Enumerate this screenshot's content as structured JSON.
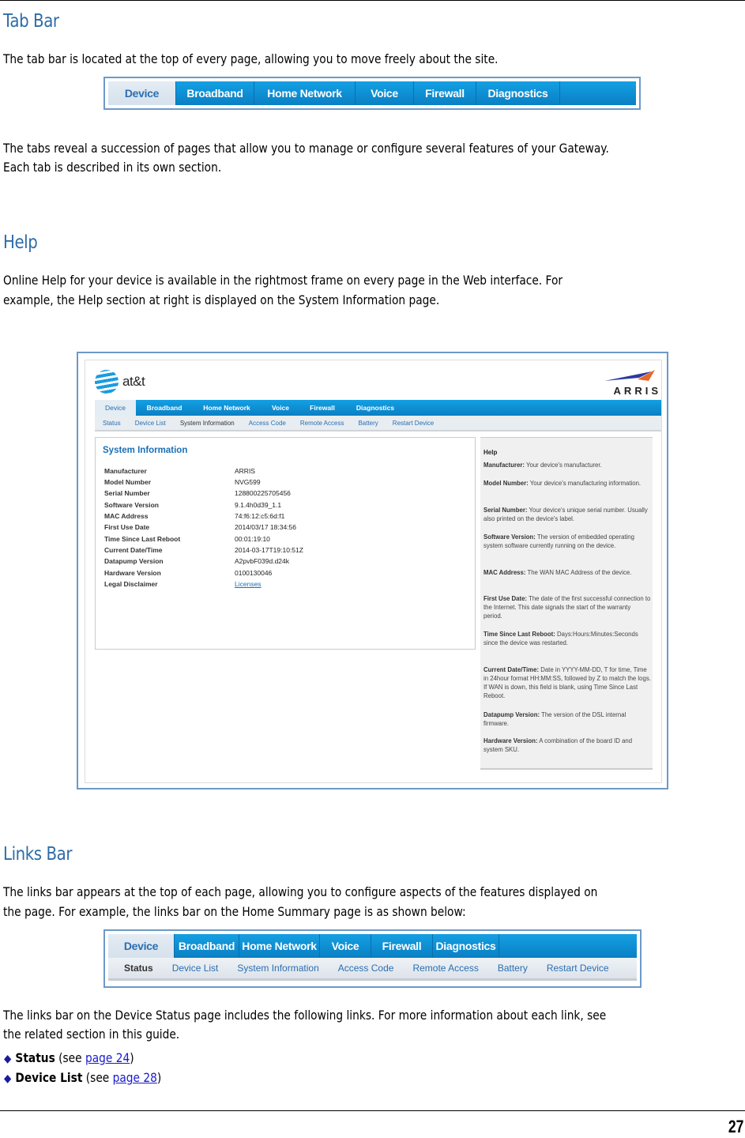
{
  "sections": {
    "tab_bar": {
      "heading": "Tab Bar",
      "intro": "The tab bar is located at the top of every page, allowing you to move freely about the site.",
      "tabs": [
        "Device",
        "Broadband",
        "Home Network",
        "Voice",
        "Firewall",
        "Diagnostics"
      ],
      "active_tab": "Device",
      "body_line1": "The tabs reveal a succession of pages that allow you to manage or configure several features of your Gateway.",
      "body_line2": "Each tab is described in its own section."
    },
    "help": {
      "heading": "Help",
      "body_line1": "Online Help for your device is available in the rightmost frame on every page in the Web interface. For",
      "body_line2": "example, the Help section at right is displayed on the System Information page."
    },
    "links_bar": {
      "heading": "Links Bar",
      "body_line1": "The links bar appears at the top of each page, allowing you to configure aspects of the features displayed on",
      "body_line2": "the page. For example, the links bar on the Home Summary page is as shown below:",
      "tabs": [
        "Device",
        "Broadband",
        "Home Network",
        "Voice",
        "Firewall",
        "Diagnostics"
      ],
      "links": [
        "Status",
        "Device List",
        "System Information",
        "Access Code",
        "Remote Access",
        "Battery",
        "Restart Device"
      ],
      "active_link": "Status",
      "after_line1": "The links bar on the Device Status page includes the following links. For more information about each link, see",
      "after_line2": "the related section in this guide.",
      "bullets": [
        {
          "term": "Status",
          "see": " (see ",
          "link": "page 24",
          "close": ")"
        },
        {
          "term": "Device List",
          "see": " (see ",
          "link": "page 28",
          "close": ")"
        }
      ]
    }
  },
  "embedded_screenshot": {
    "brand_left": "at&t",
    "brand_right": "ARRIS",
    "tabs": [
      "Device",
      "Broadband",
      "Home Network",
      "Voice",
      "Firewall",
      "Diagnostics"
    ],
    "links": [
      "Status",
      "Device List",
      "System Information",
      "Access Code",
      "Remote Access",
      "Battery",
      "Restart Device"
    ],
    "active_link": "System Information",
    "panel_title": "System Information",
    "rows": [
      {
        "label": "Manufacturer",
        "value": "ARRIS"
      },
      {
        "label": "Model Number",
        "value": "NVG599"
      },
      {
        "label": "Serial Number",
        "value": "128800225705456"
      },
      {
        "label": "Software Version",
        "value": "9.1.4h0d39_1.1"
      },
      {
        "label": "MAC Address",
        "value": "74:f6:12:c5:6d:f1"
      },
      {
        "label": "First Use Date",
        "value": "2014/03/17 18:34:56"
      },
      {
        "label": "Time Since Last Reboot",
        "value": "00:01:19:10"
      },
      {
        "label": "Current Date/Time",
        "value": "2014-03-17T19:10:51Z"
      },
      {
        "label": "Datapump Version",
        "value": "A2pvbF039d.d24k"
      },
      {
        "label": "Hardware Version",
        "value": "0100130046"
      },
      {
        "label": "Legal Disclaimer",
        "value": "Licenses"
      }
    ],
    "help_title": "Help",
    "help_items": [
      {
        "term": "Manufacturer:",
        "text": " Your device's manufacturer."
      },
      {
        "term": "Model Number:",
        "text": " Your device's manufacturing information."
      },
      {
        "term": "Serial Number:",
        "text": " Your device's unique serial number. Usually also printed on the device's label."
      },
      {
        "term": "Software Version:",
        "text": " The version of embedded operating system software currently running on the device."
      },
      {
        "term": "MAC Address:",
        "text": " The WAN MAC Address of the device."
      },
      {
        "term": "First Use Date:",
        "text": " The date of the first successful connection to the Internet. This date signals the start of the warranty period."
      },
      {
        "term": "Time Since Last Reboot:",
        "text": " Days:Hours:Minutes:Seconds since the device was restarted."
      },
      {
        "term": "Current Date/Time:",
        "text": " Date in YYYY-MM-DD, T for time, Time in 24hour format HH:MM:SS, followed by Z to match the logs. If WAN is down, this field is blank, using Time Since Last Reboot."
      },
      {
        "term": "Datapump Version:",
        "text": " The version of the DSL internal firmware."
      },
      {
        "term": "Hardware Version:",
        "text": " A combination of the board ID and system SKU."
      }
    ]
  },
  "footer": {
    "page_number": "27"
  },
  "colors": {
    "heading": "#2e6ca6",
    "tab_blue": "#0a8fd6",
    "frame_border": "#6d99c8",
    "link": "#1a1acc"
  }
}
